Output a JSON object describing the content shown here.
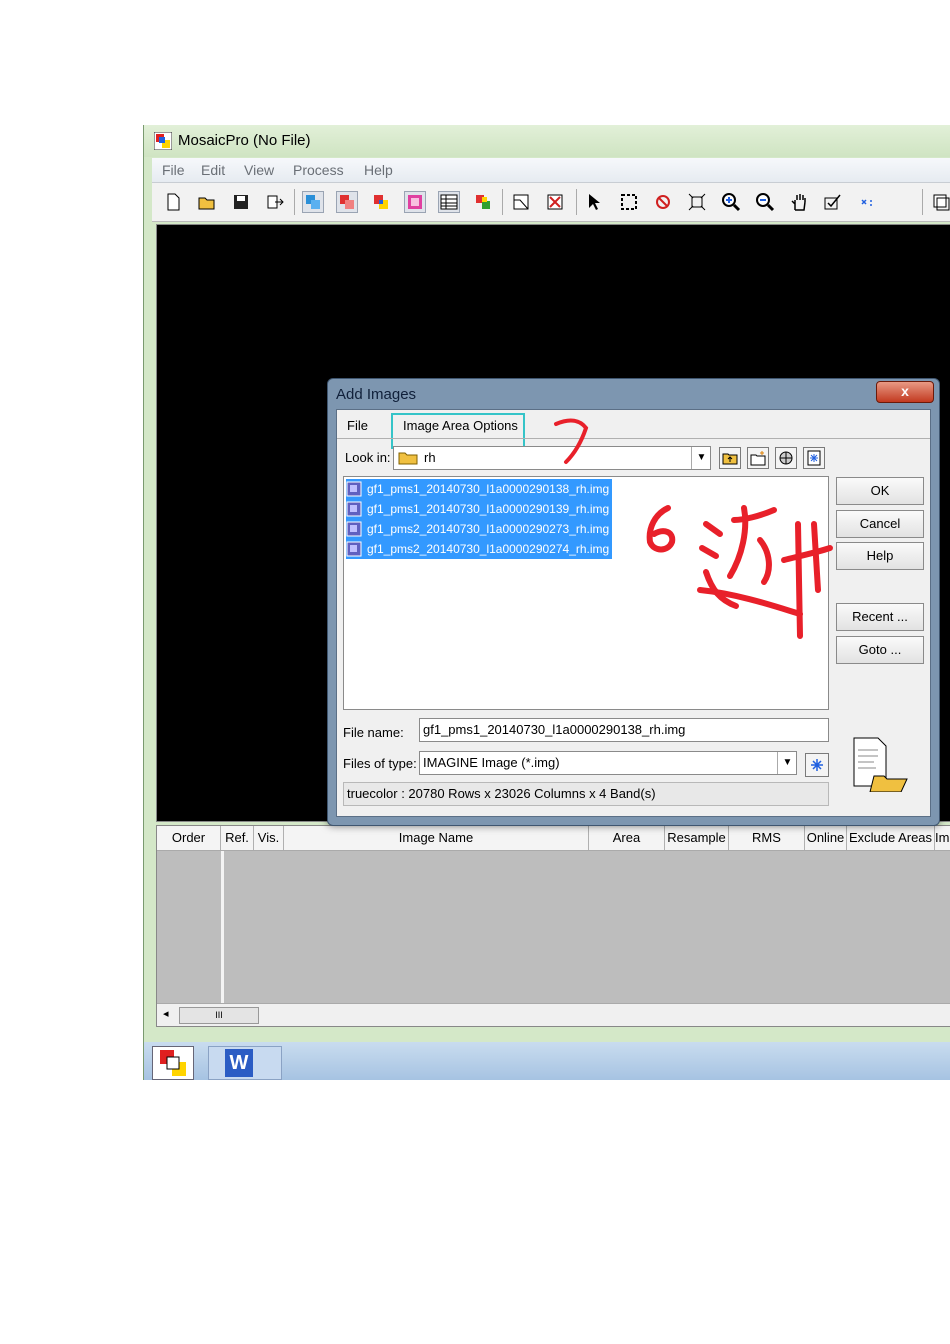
{
  "window": {
    "title": "MosaicPro (No File)"
  },
  "menu": [
    "File",
    "Edit",
    "View",
    "Process",
    "Help"
  ],
  "toolbar_icons": [
    "new-file-icon",
    "open-folder-icon",
    "save-icon",
    "export-icon",
    "display-all-icon",
    "display-selected-icon",
    "display-overlap-icon",
    "display-active-icon",
    "table-icon",
    "color-correct-icon",
    "cutline-icon",
    "cutline-delete-icon",
    "select-arrow-icon",
    "marquee-icon",
    "ring-icon",
    "fit-icon",
    "zoom-in-icon",
    "zoom-out-icon",
    "pan-hand-icon",
    "checkmark-icon",
    "point-icon",
    "more-icon"
  ],
  "table": {
    "columns": [
      "Order",
      "Ref.",
      "Vis.",
      "Image Name",
      "Area",
      "Resample",
      "RMS",
      "Online",
      "Exclude Areas",
      "Im"
    ]
  },
  "dialog": {
    "title": "Add Images",
    "close_label": "x",
    "tabs": [
      "File",
      "Image Area Options"
    ],
    "look_in_label": "Look in:",
    "look_in_value": "rh",
    "files": [
      "gf1_pms1_20140730_l1a0000290138_rh.img",
      "gf1_pms1_20140730_l1a0000290139_rh.img",
      "gf1_pms2_20140730_l1a0000290273_rh.img",
      "gf1_pms2_20140730_l1a0000290274_rh.img"
    ],
    "buttons": {
      "ok": "OK",
      "cancel": "Cancel",
      "help": "Help",
      "recent": "Recent ...",
      "goto": "Goto ..."
    },
    "file_name_label": "File name:",
    "file_name_value": "gf1_pms1_20140730_l1a0000290138_rh.img",
    "file_type_label": "Files of type:",
    "file_type_value": "IMAGINE Image (*.img)",
    "status": "truecolor : 20780 Rows x 23026 Columns x 4 Band(s)"
  },
  "annotations": {
    "step7": "7",
    "step6": "6",
    "note": "选中"
  },
  "colors": {
    "selection": "#3399ff",
    "highlight_box": "#35c4c8",
    "annotation": "#e8202a"
  }
}
